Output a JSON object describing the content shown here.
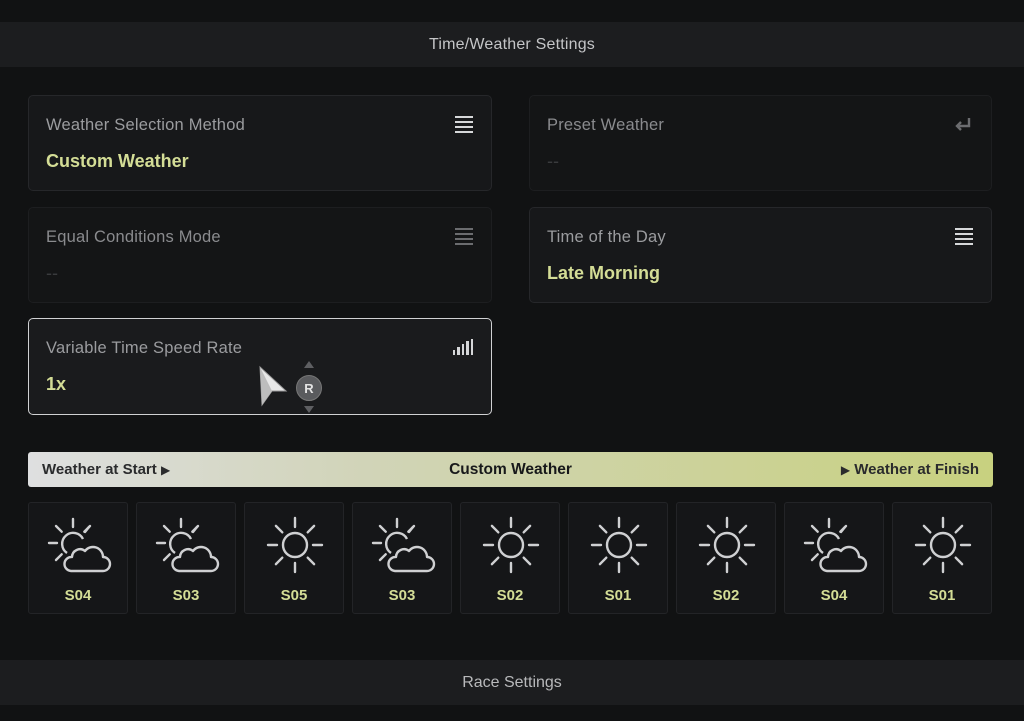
{
  "header": {
    "title": "Time/Weather Settings"
  },
  "settings": {
    "weather_method": {
      "label": "Weather Selection Method",
      "value": "Custom Weather",
      "icon": "menu-icon"
    },
    "preset_weather": {
      "label": "Preset Weather",
      "value": "--",
      "icon": "return-icon"
    },
    "equal_conditions": {
      "label": "Equal Conditions Mode",
      "value": "--",
      "icon": "menu-icon"
    },
    "time_of_day": {
      "label": "Time of the Day",
      "value": "Late Morning",
      "icon": "menu-icon"
    },
    "time_speed": {
      "label": "Variable Time Speed Rate",
      "value": "1x",
      "icon": "bars-icon"
    }
  },
  "controller": {
    "r_button": "R"
  },
  "weather_bar": {
    "start": "Weather at Start",
    "center": "Custom Weather",
    "finish": "Weather at Finish"
  },
  "weather_slots": [
    {
      "code": "S04",
      "icon": "sun-cloud-icon"
    },
    {
      "code": "S03",
      "icon": "sun-cloud-icon"
    },
    {
      "code": "S05",
      "icon": "sun-icon"
    },
    {
      "code": "S03",
      "icon": "sun-cloud-icon"
    },
    {
      "code": "S02",
      "icon": "sun-icon"
    },
    {
      "code": "S01",
      "icon": "sun-icon"
    },
    {
      "code": "S02",
      "icon": "sun-icon"
    },
    {
      "code": "S04",
      "icon": "sun-cloud-icon"
    },
    {
      "code": "S01",
      "icon": "sun-icon"
    }
  ],
  "footer": {
    "title": "Race Settings"
  },
  "colors": {
    "accent": "#d4dd96",
    "background": "#111213"
  }
}
